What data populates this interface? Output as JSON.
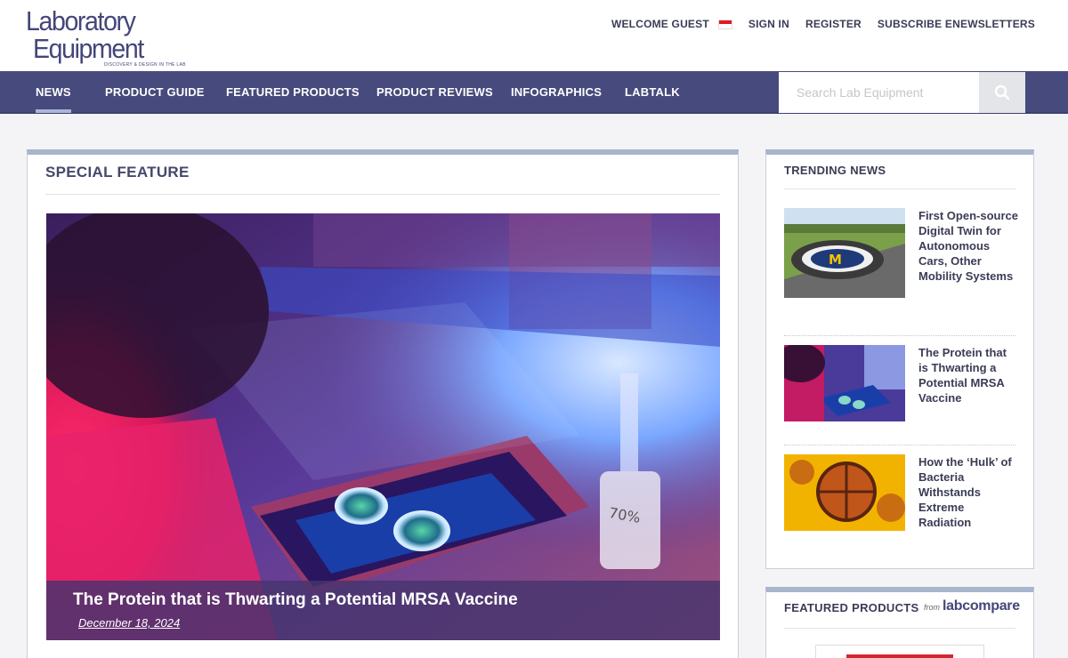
{
  "header": {
    "logo_line1": "Laboratory",
    "logo_line2": "Equipment",
    "logo_tagline": "DISCOVERY & DESIGN IN THE LAB",
    "welcome": "WELCOME GUEST",
    "links": [
      "SIGN IN",
      "REGISTER",
      "SUBSCRIBE ENEWSLETTERS"
    ]
  },
  "nav": {
    "items": [
      "NEWS",
      "PRODUCT GUIDE",
      "FEATURED PRODUCTS",
      "PRODUCT REVIEWS",
      "INFOGRAPHICS",
      "LABTALK"
    ],
    "active": "NEWS",
    "search_placeholder": "Search Lab Equipment",
    "search_icon": "search-icon"
  },
  "main": {
    "section_title": "SPECIAL FEATURE",
    "hero_title": "The Protein that is Thwarting a Potential MRSA Vaccine",
    "hero_date": "December 18, 2024",
    "hero_image": "lab-researcher-blue-light-petri-dishes"
  },
  "trending": {
    "title": "TRENDING NEWS",
    "items": [
      {
        "title": "First Open-source Digital Twin for Autonomous Cars, Other Mobility Systems",
        "image": "aerial-michigan-m-test-track"
      },
      {
        "title": "The Protein that is Thwarting a Potential MRSA Vaccine",
        "image": "lab-researcher-thumbnail"
      },
      {
        "title": "How the ‘Hulk’ of Bacteria Withstands Extreme Radiation",
        "image": "bacteria-microscopy"
      }
    ]
  },
  "featured": {
    "title": "FEATURED PRODUCTS",
    "from": "from",
    "brand": "labcompare"
  },
  "colors": {
    "brand": "#474a7c",
    "accent_bar": "#a9b4cd",
    "flag_red": "#e21b23"
  }
}
